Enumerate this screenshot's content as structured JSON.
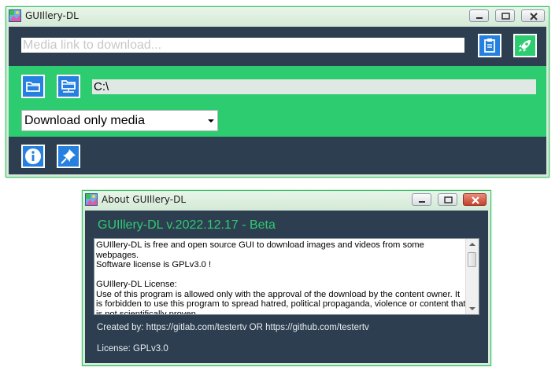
{
  "main_window": {
    "title": "GUIllery-DL",
    "url_input": {
      "placeholder": "Media link to download...",
      "value": ""
    },
    "paste_button_icon": "clipboard-icon",
    "download_button_icon": "rocket-icon",
    "open_folder_icon": "folder-open-icon",
    "choose_folder_icon": "folder-network-icon",
    "download_path": "C:\\",
    "mode_select": {
      "selected": "Download only media"
    },
    "info_button_icon": "info-icon",
    "pin_button_icon": "pin-icon"
  },
  "about_window": {
    "title": "About GUIllery-DL",
    "heading": "GUIllery-DL v.2022.12.17 - Beta",
    "text": "GUIllery-DL is free and open source GUI to download images and videos from some webpages.\nSoftware license is GPLv3.0 !\n\nGUIllery-DL License:\nUse of this program is allowed only with the approval of the download by the content owner. It is forbidden to use this program to spread hatred, political propaganda, violence or content that is not scientifically proven.",
    "created_by": "Created by: https://gitlab.com/testertv OR https://github.com/testertv",
    "license": "License: GPLv3.0"
  },
  "colors": {
    "dark_panel": "#2d3e50",
    "green_panel": "#2ecc71",
    "button_blue": "#2580e0",
    "window_border": "#3fc267"
  }
}
